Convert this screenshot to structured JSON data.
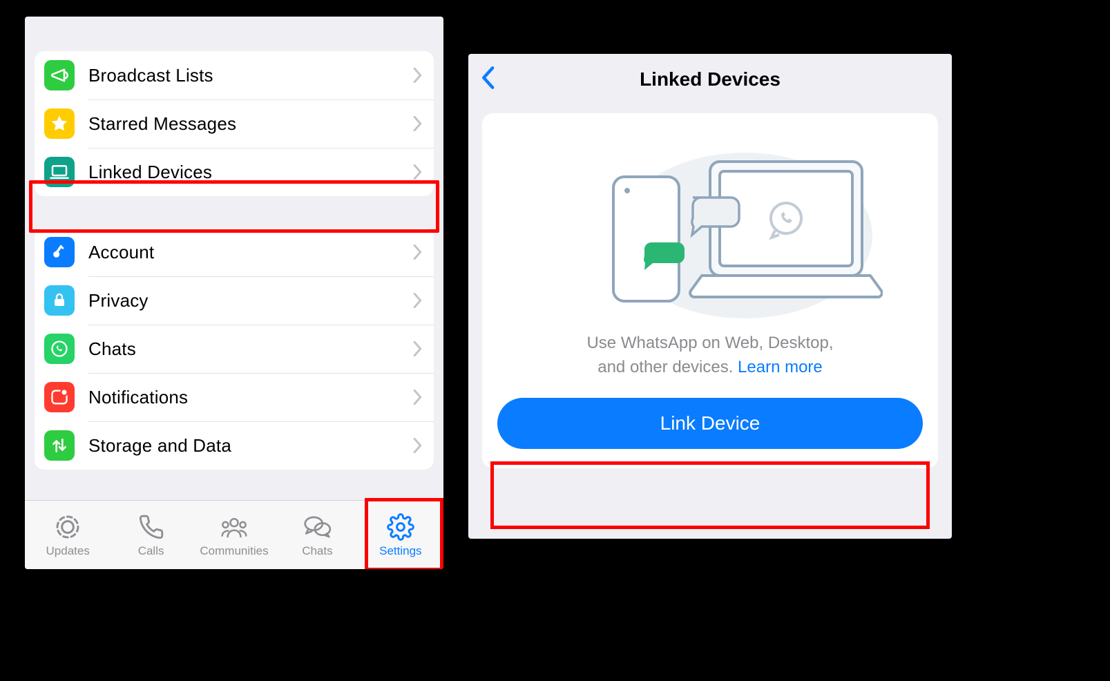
{
  "settings": {
    "group1": [
      {
        "id": "broadcast-lists",
        "label": "Broadcast Lists",
        "icon": "megaphone",
        "bg": "#2ecc40"
      },
      {
        "id": "starred-messages",
        "label": "Starred Messages",
        "icon": "star",
        "bg": "#ffcc00"
      },
      {
        "id": "linked-devices",
        "label": "Linked Devices",
        "icon": "laptop",
        "bg": "#0fa28a"
      }
    ],
    "group2": [
      {
        "id": "account",
        "label": "Account",
        "icon": "key",
        "bg": "#0a7cff"
      },
      {
        "id": "privacy",
        "label": "Privacy",
        "icon": "lock",
        "bg": "#34c2f0"
      },
      {
        "id": "chats",
        "label": "Chats",
        "icon": "whatsapp",
        "bg": "#25d366"
      },
      {
        "id": "notifications",
        "label": "Notifications",
        "icon": "notif",
        "bg": "#ff3b30"
      },
      {
        "id": "storage",
        "label": "Storage and Data",
        "icon": "updown",
        "bg": "#2ecc40"
      }
    ]
  },
  "tabbar": {
    "items": [
      {
        "id": "updates",
        "label": "Updates"
      },
      {
        "id": "calls",
        "label": "Calls"
      },
      {
        "id": "communities",
        "label": "Communities"
      },
      {
        "id": "chats",
        "label": "Chats"
      },
      {
        "id": "settings",
        "label": "Settings"
      }
    ],
    "active": "settings"
  },
  "linked": {
    "title": "Linked Devices",
    "desc_line1": "Use WhatsApp on Web, Desktop,",
    "desc_line2": "and other devices. ",
    "learn_more": "Learn more",
    "button": "Link Device"
  }
}
